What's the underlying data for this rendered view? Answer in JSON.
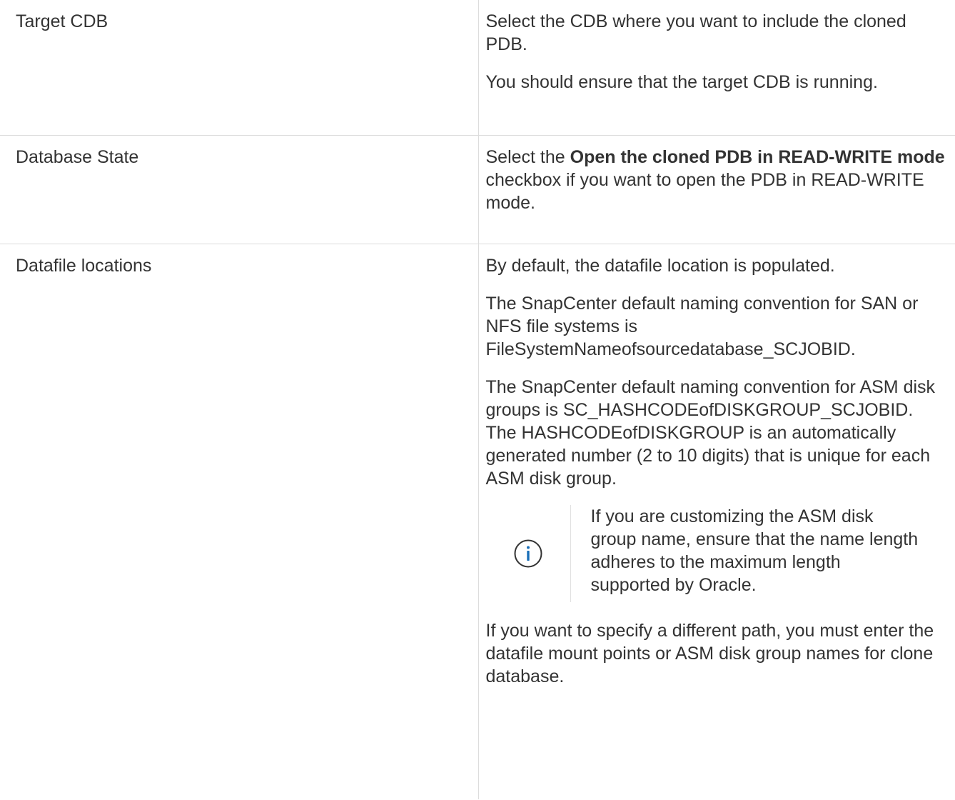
{
  "rows": [
    {
      "parameter": "Target CDB",
      "paragraphs": [
        "Select the CDB where you want to include the cloned PDB.",
        "You should ensure that the target CDB is running."
      ]
    },
    {
      "parameter": "Database State",
      "desc_prefix": "Select the ",
      "desc_bold": "Open the cloned PDB in READ-WRITE mode",
      "desc_suffix": " checkbox if you want to open the PDB in READ-WRITE mode."
    },
    {
      "parameter": "Datafile locations",
      "paragraphs": [
        "By default, the datafile location is populated.",
        "The SnapCenter default naming convention for SAN or NFS file systems is FileSystemNameofsourcedatabase_SCJOBID.",
        "The SnapCenter default naming convention for ASM disk groups is SC_HASHCODEofDISKGROUP_SCJOBID. The HASHCODEofDISKGROUP is an automatically generated number (2 to 10 digits) that is unique for each ASM disk group."
      ],
      "note": {
        "icon": "info-icon",
        "text": "If you are customizing the ASM disk group name, ensure that the name length adheres to the maximum length supported by Oracle."
      },
      "final_paragraph": "If you want to specify a different path, you must enter the datafile mount points or ASM disk group names for clone database."
    }
  ],
  "colors": {
    "text": "#333333",
    "border": "#dcdcdc",
    "icon": "#1a6fb8"
  }
}
